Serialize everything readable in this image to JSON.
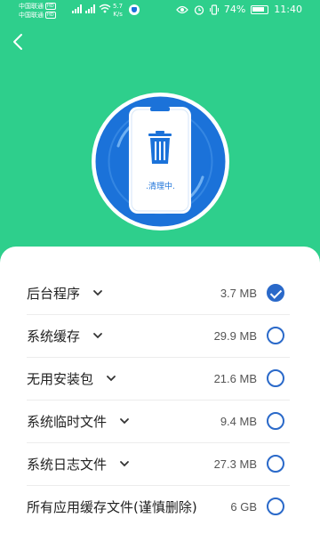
{
  "status": {
    "carrier1": "中国联通",
    "carrier2": "中国联通",
    "hd": "HD",
    "net1": "4G",
    "net2": "4G",
    "speed_value": "5.7",
    "speed_unit": "K/s",
    "battery": "74%",
    "time": "11:40"
  },
  "hero": {
    "status_text": ".清理中."
  },
  "items": [
    {
      "label": "后台程序",
      "size": "3.7 MB",
      "checked": true,
      "has_chevron": true
    },
    {
      "label": "系统缓存",
      "size": "29.9 MB",
      "checked": false,
      "has_chevron": true
    },
    {
      "label": "无用安装包",
      "size": "21.6 MB",
      "checked": false,
      "has_chevron": true
    },
    {
      "label": "系统临时文件",
      "size": "9.4 MB",
      "checked": false,
      "has_chevron": true
    },
    {
      "label": "系统日志文件",
      "size": "27.3 MB",
      "checked": false,
      "has_chevron": true
    },
    {
      "label": "所有应用缓存文件(谨慎删除)",
      "size": "6 GB",
      "checked": false,
      "has_chevron": false
    }
  ],
  "colors": {
    "brand_green": "#2ecf8c",
    "accent_blue": "#2a69c9",
    "hero_blue": "#1b72d9"
  }
}
